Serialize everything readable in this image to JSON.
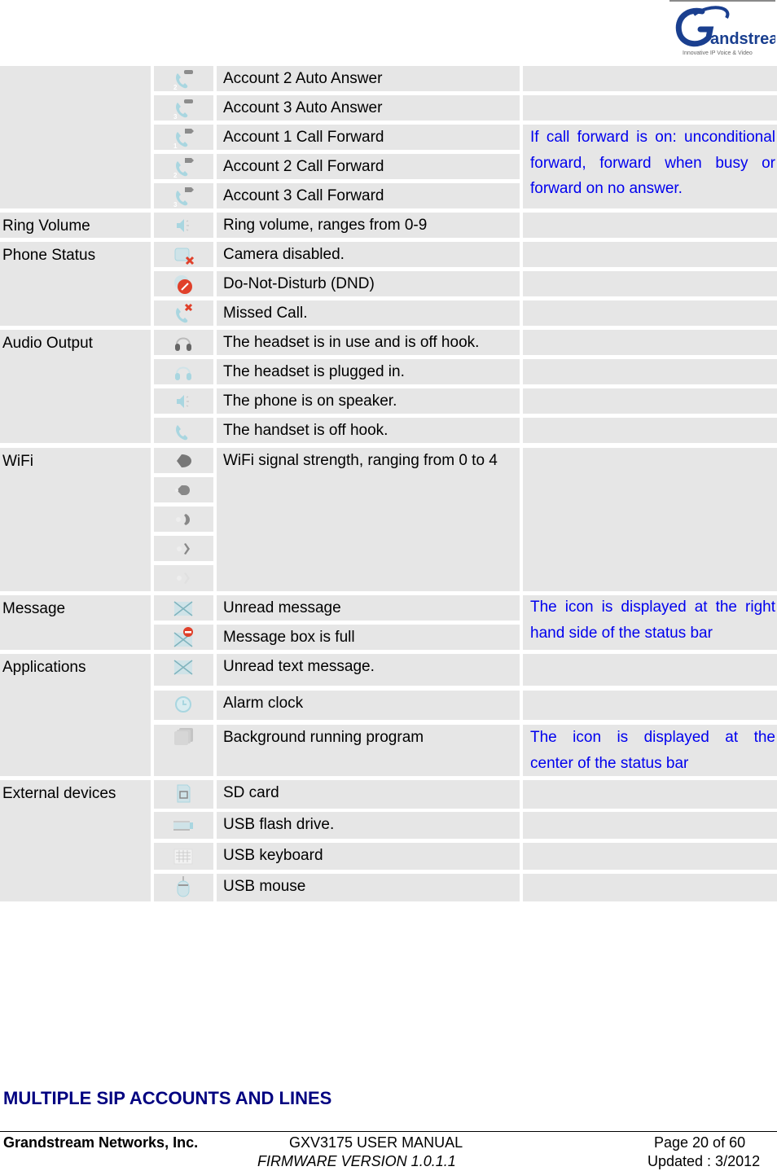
{
  "header": {
    "logo": {
      "name": "Grandstream",
      "tagline": "Innovative IP Voice & Video"
    }
  },
  "table": {
    "rows": [
      {
        "category": "",
        "icon": "account-2-auto-answer-icon",
        "description": "Account 2 Auto Answer",
        "note": ""
      },
      {
        "category": "",
        "icon": "account-3-auto-answer-icon",
        "description": "Account 3 Auto Answer",
        "note": ""
      },
      {
        "category": "",
        "icon": "account-1-call-forward-icon",
        "description": "Account 1 Call Forward",
        "note": "If call forward is on: unconditional forward, forward when busy or forward on no answer."
      },
      {
        "category": "",
        "icon": "account-2-call-forward-icon",
        "description": "Account 2 Call Forward",
        "note": ""
      },
      {
        "category": "",
        "icon": "account-3-call-forward-icon",
        "description": "Account 3 Call Forward",
        "note": ""
      },
      {
        "category": "Ring Volume",
        "icon": "ring-volume-icon",
        "description": "Ring volume, ranges from 0-9",
        "note": ""
      },
      {
        "category": "Phone Status",
        "icon": "camera-disabled-icon",
        "description": "Camera disabled.",
        "note": ""
      },
      {
        "category": "",
        "icon": "dnd-icon",
        "description": "Do-Not-Disturb (DND)",
        "note": ""
      },
      {
        "category": "",
        "icon": "missed-call-icon",
        "description": "Missed Call.",
        "note": ""
      },
      {
        "category": "Audio Output",
        "icon": "headset-in-use-icon",
        "description": "The headset is in use and is off hook.",
        "note": ""
      },
      {
        "category": "",
        "icon": "headset-plugged-icon",
        "description": "The headset is plugged in.",
        "note": ""
      },
      {
        "category": "",
        "icon": "speaker-icon",
        "description": "The phone is on speaker.",
        "note": ""
      },
      {
        "category": "",
        "icon": "handset-off-hook-icon",
        "description": "The handset is off hook.",
        "note": ""
      },
      {
        "category": "WiFi",
        "icon": "wifi-signal-4-icon",
        "description": "WiFi signal strength, ranging from 0 to 4",
        "note": ""
      },
      {
        "category": "",
        "icon": "wifi-signal-3-icon",
        "description": "",
        "note": ""
      },
      {
        "category": "",
        "icon": "wifi-signal-2-icon",
        "description": "",
        "note": ""
      },
      {
        "category": "",
        "icon": "wifi-signal-1-icon",
        "description": "",
        "note": ""
      },
      {
        "category": "",
        "icon": "wifi-signal-0-icon",
        "description": "",
        "note": ""
      },
      {
        "category": "Message",
        "icon": "unread-message-icon",
        "description": "Unread message",
        "note": "The icon is displayed at the right hand side of the status bar"
      },
      {
        "category": "",
        "icon": "message-box-full-icon",
        "description": "Message box is full",
        "note": ""
      },
      {
        "category": "Applications",
        "icon": "unread-text-message-icon",
        "description": "Unread text message.",
        "note": ""
      },
      {
        "category": "",
        "icon": "alarm-clock-icon",
        "description": "Alarm clock",
        "note": ""
      },
      {
        "category": "",
        "icon": "background-program-icon",
        "description": "Background running program",
        "note": "The icon is displayed at the center of the status bar"
      },
      {
        "category": "External devices",
        "icon": "sd-card-icon",
        "description": "SD card",
        "note": ""
      },
      {
        "category": "",
        "icon": "usb-flash-drive-icon",
        "description": "USB flash drive.",
        "note": ""
      },
      {
        "category": "",
        "icon": "usb-keyboard-icon",
        "description": "USB keyboard",
        "note": ""
      },
      {
        "category": "",
        "icon": "usb-mouse-icon",
        "description": "USB mouse",
        "note": ""
      }
    ],
    "notes": {
      "call_forward_l1": "If call forward is on: unconditional",
      "call_forward_l2": "forward, forward when busy or",
      "call_forward_l3": "forward on no answer.",
      "message_l1": "The icon is displayed at the right",
      "message_l2": "hand side of the status bar",
      "apps_l1": "The icon is displayed at the",
      "apps_l2": "center of the status bar"
    }
  },
  "section": {
    "title": "MULTIPLE SIP ACCOUNTS AND LINES"
  },
  "footer": {
    "company": "Grandstream Networks, Inc.",
    "manual": "GXV3175 USER MANUAL",
    "firmware": "FIRMWARE VERSION 1.0.1.1",
    "page": "Page 20 of 60",
    "updated": "Updated : 3/2012"
  },
  "colors": {
    "cell_bg": "#e6e6e6",
    "note_text": "#0000ee",
    "section_title": "#000080"
  }
}
